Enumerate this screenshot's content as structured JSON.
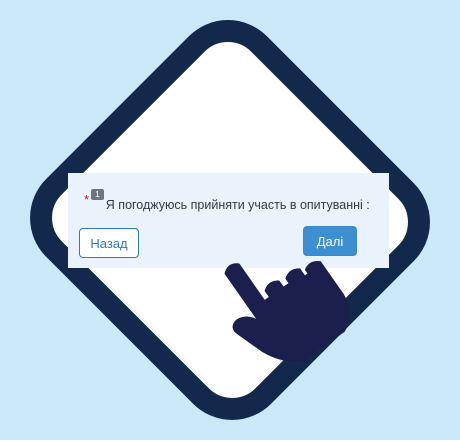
{
  "question": {
    "required_mark": "*",
    "number": "1",
    "text": "Я погоджуюсь прийняти участь в опитуванні :"
  },
  "buttons": {
    "back_label": "Назад",
    "next_label": "Далі"
  },
  "colors": {
    "background": "#cbe8f8",
    "diamond_border": "#13294b",
    "card": "#eaf3fb",
    "primary": "#3d8fd1",
    "hand": "#1b1f4d"
  },
  "icons": {
    "pointer": "pointing-hand-icon"
  }
}
